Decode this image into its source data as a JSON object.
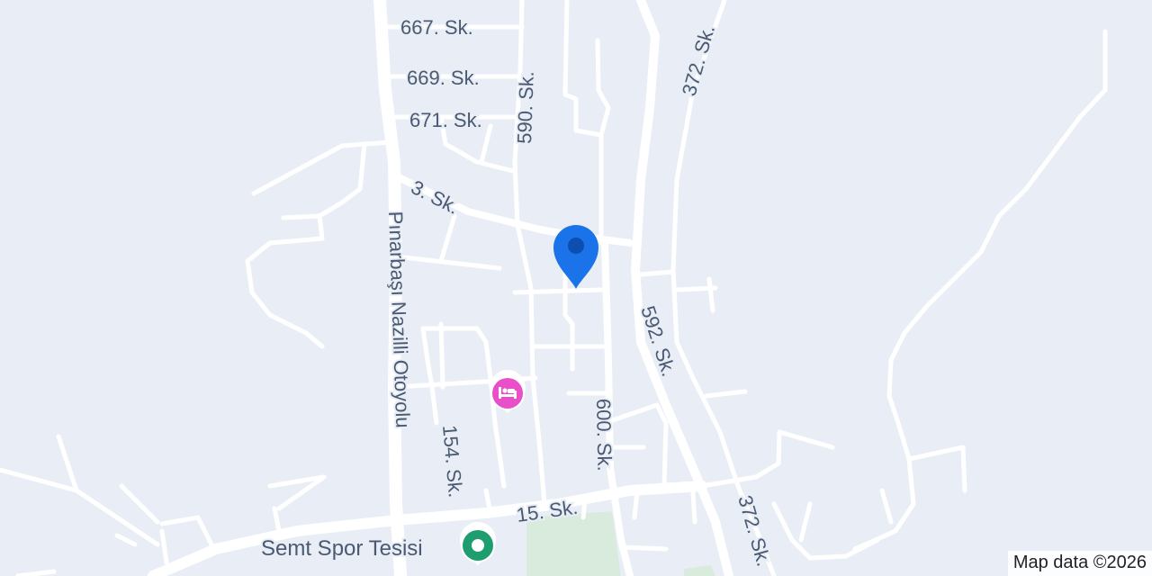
{
  "map": {
    "background_color": "#e9eef6",
    "park_color": "#d8ebdc",
    "road_color": "#ffffff",
    "label_color": "#4a5a72"
  },
  "streets": {
    "s667": "667. Sk.",
    "s669": "669. Sk.",
    "s671": "671. Sk.",
    "s590": "590. Sk.",
    "s372_top": "372. Sk.",
    "s3": "3. Sk.",
    "highway": "Pınarbaşı Nazilli Otoyolu",
    "s592": "592. Sk.",
    "s600": "600. Sk.",
    "s154": "154. Sk.",
    "s15": "15. Sk.",
    "s372_bottom": "372. Sk."
  },
  "pois": {
    "sports": {
      "name": "Semt Spor Tesisi",
      "icon": "sports-facility-icon",
      "color": "#1e9e6e"
    },
    "hotel": {
      "name": "",
      "icon": "hotel-bed-icon",
      "color": "#e84fc8"
    }
  },
  "location_pin": {
    "icon": "location-pin-icon",
    "color": "#1a73e8"
  },
  "attribution": "Map data ©2026"
}
